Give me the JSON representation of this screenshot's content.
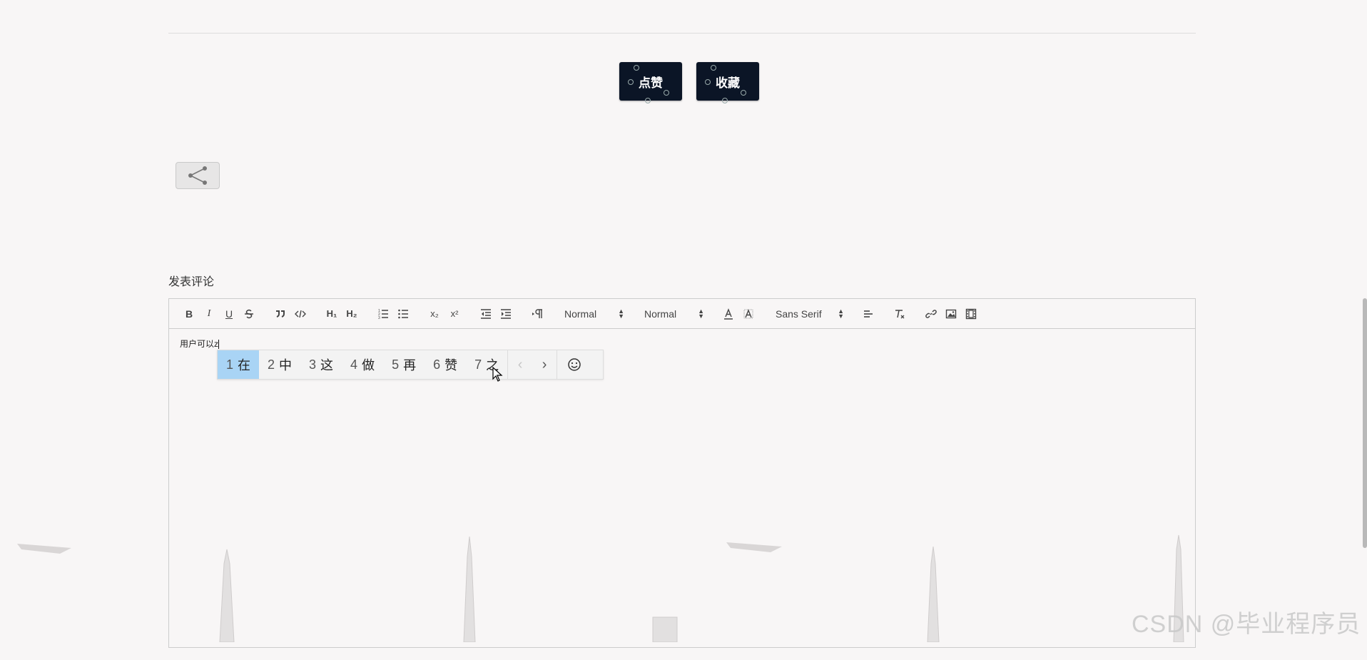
{
  "actions": {
    "like_label": "点赞",
    "favorite_label": "收藏"
  },
  "share": {
    "icon": "share-icon"
  },
  "comment": {
    "title": "发表评论"
  },
  "toolbar": {
    "header_select": "Normal",
    "size_select": "Normal",
    "font_select": "Sans Serif",
    "sub_script": "x₂",
    "super_script": "x²",
    "h1": "H₁",
    "h2": "H₂",
    "bold": "B",
    "italic": "I",
    "underline": "U"
  },
  "editor": {
    "content": "用户可以z"
  },
  "ime": {
    "candidates": [
      {
        "num": "1",
        "char": "在"
      },
      {
        "num": "2",
        "char": "中"
      },
      {
        "num": "3",
        "char": "这"
      },
      {
        "num": "4",
        "char": "做"
      },
      {
        "num": "5",
        "char": "再"
      },
      {
        "num": "6",
        "char": "赞"
      },
      {
        "num": "7",
        "char": "之"
      }
    ],
    "prev": "‹",
    "next": "›",
    "emoji": "☺"
  },
  "watermark": "CSDN @毕业程序员"
}
